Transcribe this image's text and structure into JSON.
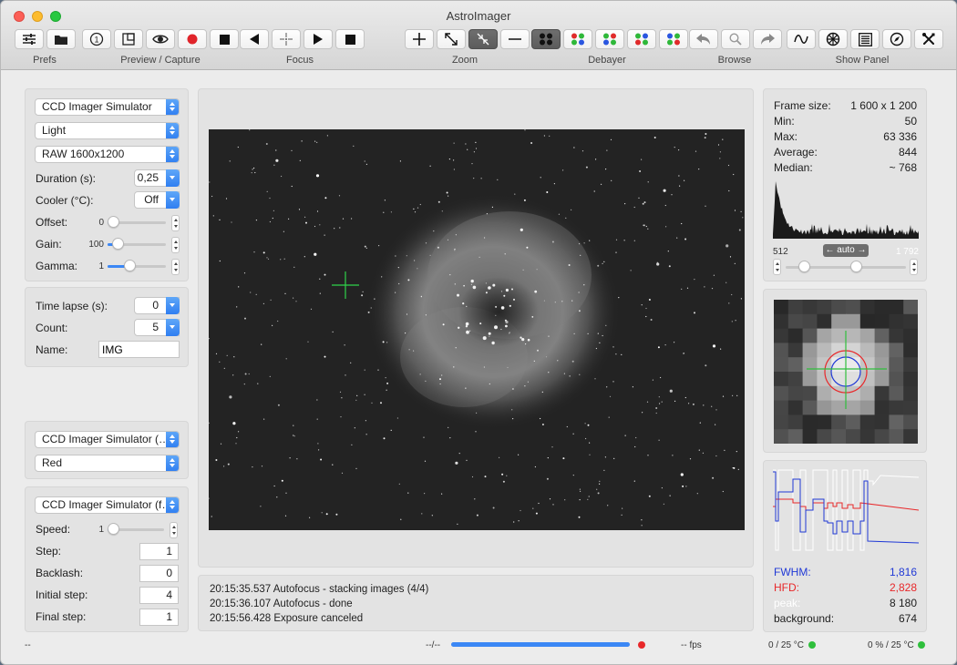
{
  "window": {
    "title": "AstroImager"
  },
  "toolbar": {
    "groups": {
      "prefs": "Prefs",
      "preview_capture": "Preview / Capture",
      "focus": "Focus",
      "zoom": "Zoom",
      "debayer": "Debayer",
      "browse": "Browse",
      "show_panel": "Show Panel"
    },
    "single_shot_label": "1"
  },
  "ccd": {
    "device": "CCD Imager Simulator",
    "frame_type": "Light",
    "frame_format": "RAW 1600x1200",
    "duration_label": "Duration (s):",
    "duration_value": "0,25",
    "cooler_label": "Cooler (°C):",
    "cooler_value": "Off",
    "offset_label": "Offset:",
    "offset_value": "0",
    "offset_level": 0.0,
    "gain_label": "Gain:",
    "gain_value": "100",
    "gain_level": 0.1,
    "gamma_label": "Gamma:",
    "gamma_value": "1",
    "gamma_level": 0.35
  },
  "sequence": {
    "time_lapse_label": "Time lapse (s):",
    "time_lapse_value": "0",
    "count_label": "Count:",
    "count_value": "5",
    "name_label": "Name:",
    "name_value": "IMG"
  },
  "wheel": {
    "device": "CCD Imager Simulator (…",
    "filter": "Red"
  },
  "focuser": {
    "device": "CCD Imager Simulator (f…",
    "speed_label": "Speed:",
    "speed_value": "1",
    "speed_level": 0.0,
    "step_label": "Step:",
    "step_value": "1",
    "backlash_label": "Backlash:",
    "backlash_value": "0",
    "initial_step_label": "Initial step:",
    "initial_step_value": "4",
    "final_step_label": "Final step:",
    "final_step_value": "1"
  },
  "log": [
    "20:15:35.537 Autofocus - stacking images (4/4)",
    "20:15:36.107 Autofocus - done",
    "20:15:56.428 Exposure canceled"
  ],
  "stats": {
    "frame_size_label": "Frame size:",
    "frame_size_value": "1 600 x 1 200",
    "min_label": "Min:",
    "min_value": "50",
    "max_label": "Max:",
    "max_value": "63 336",
    "average_label": "Average:",
    "average_value": "844",
    "median_label": "Median:",
    "median_value": "~ 768"
  },
  "histogram": {
    "low": "512",
    "mode": "← auto →",
    "high": "1 792",
    "low_level": 0.12,
    "high_level": 0.6
  },
  "focus_stats": {
    "fwhm_label": "FWHM:",
    "fwhm_value": "1,816",
    "hfd_label": "HFD:",
    "hfd_value": "2,828",
    "peak_label": "peak:",
    "peak_value": "8 180",
    "background_label": "background:",
    "background_value": "674"
  },
  "status": {
    "left": "--",
    "frames": "--/--",
    "fps": "-- fps",
    "ccd_temp": "0 / 25 °C",
    "cooler_power": "0 % / 25 °C",
    "progress": 1.0
  },
  "colors": {
    "accent": "#3b87f5",
    "record": "#e0242a",
    "ok": "#2fbf3c",
    "fwhm": "#2039d6",
    "hfd": "#e8282a",
    "peak": "#ffffff"
  }
}
